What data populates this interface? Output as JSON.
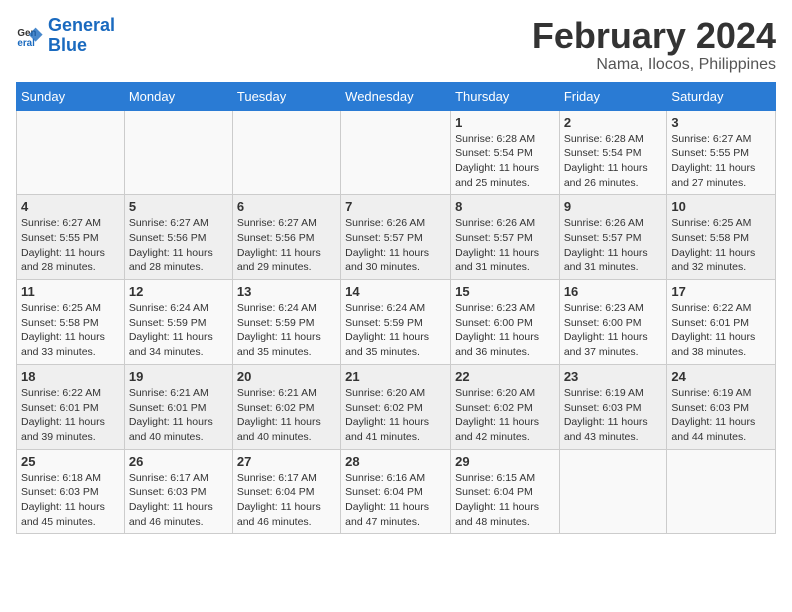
{
  "logo": {
    "line1": "General",
    "line2": "Blue"
  },
  "title": "February 2024",
  "location": "Nama, Ilocos, Philippines",
  "days_header": [
    "Sunday",
    "Monday",
    "Tuesday",
    "Wednesday",
    "Thursday",
    "Friday",
    "Saturday"
  ],
  "weeks": [
    [
      {
        "num": "",
        "info": ""
      },
      {
        "num": "",
        "info": ""
      },
      {
        "num": "",
        "info": ""
      },
      {
        "num": "",
        "info": ""
      },
      {
        "num": "1",
        "info": "Sunrise: 6:28 AM\nSunset: 5:54 PM\nDaylight: 11 hours and 25 minutes."
      },
      {
        "num": "2",
        "info": "Sunrise: 6:28 AM\nSunset: 5:54 PM\nDaylight: 11 hours and 26 minutes."
      },
      {
        "num": "3",
        "info": "Sunrise: 6:27 AM\nSunset: 5:55 PM\nDaylight: 11 hours and 27 minutes."
      }
    ],
    [
      {
        "num": "4",
        "info": "Sunrise: 6:27 AM\nSunset: 5:55 PM\nDaylight: 11 hours and 28 minutes."
      },
      {
        "num": "5",
        "info": "Sunrise: 6:27 AM\nSunset: 5:56 PM\nDaylight: 11 hours and 28 minutes."
      },
      {
        "num": "6",
        "info": "Sunrise: 6:27 AM\nSunset: 5:56 PM\nDaylight: 11 hours and 29 minutes."
      },
      {
        "num": "7",
        "info": "Sunrise: 6:26 AM\nSunset: 5:57 PM\nDaylight: 11 hours and 30 minutes."
      },
      {
        "num": "8",
        "info": "Sunrise: 6:26 AM\nSunset: 5:57 PM\nDaylight: 11 hours and 31 minutes."
      },
      {
        "num": "9",
        "info": "Sunrise: 6:26 AM\nSunset: 5:57 PM\nDaylight: 11 hours and 31 minutes."
      },
      {
        "num": "10",
        "info": "Sunrise: 6:25 AM\nSunset: 5:58 PM\nDaylight: 11 hours and 32 minutes."
      }
    ],
    [
      {
        "num": "11",
        "info": "Sunrise: 6:25 AM\nSunset: 5:58 PM\nDaylight: 11 hours and 33 minutes."
      },
      {
        "num": "12",
        "info": "Sunrise: 6:24 AM\nSunset: 5:59 PM\nDaylight: 11 hours and 34 minutes."
      },
      {
        "num": "13",
        "info": "Sunrise: 6:24 AM\nSunset: 5:59 PM\nDaylight: 11 hours and 35 minutes."
      },
      {
        "num": "14",
        "info": "Sunrise: 6:24 AM\nSunset: 5:59 PM\nDaylight: 11 hours and 35 minutes."
      },
      {
        "num": "15",
        "info": "Sunrise: 6:23 AM\nSunset: 6:00 PM\nDaylight: 11 hours and 36 minutes."
      },
      {
        "num": "16",
        "info": "Sunrise: 6:23 AM\nSunset: 6:00 PM\nDaylight: 11 hours and 37 minutes."
      },
      {
        "num": "17",
        "info": "Sunrise: 6:22 AM\nSunset: 6:01 PM\nDaylight: 11 hours and 38 minutes."
      }
    ],
    [
      {
        "num": "18",
        "info": "Sunrise: 6:22 AM\nSunset: 6:01 PM\nDaylight: 11 hours and 39 minutes."
      },
      {
        "num": "19",
        "info": "Sunrise: 6:21 AM\nSunset: 6:01 PM\nDaylight: 11 hours and 40 minutes."
      },
      {
        "num": "20",
        "info": "Sunrise: 6:21 AM\nSunset: 6:02 PM\nDaylight: 11 hours and 40 minutes."
      },
      {
        "num": "21",
        "info": "Sunrise: 6:20 AM\nSunset: 6:02 PM\nDaylight: 11 hours and 41 minutes."
      },
      {
        "num": "22",
        "info": "Sunrise: 6:20 AM\nSunset: 6:02 PM\nDaylight: 11 hours and 42 minutes."
      },
      {
        "num": "23",
        "info": "Sunrise: 6:19 AM\nSunset: 6:03 PM\nDaylight: 11 hours and 43 minutes."
      },
      {
        "num": "24",
        "info": "Sunrise: 6:19 AM\nSunset: 6:03 PM\nDaylight: 11 hours and 44 minutes."
      }
    ],
    [
      {
        "num": "25",
        "info": "Sunrise: 6:18 AM\nSunset: 6:03 PM\nDaylight: 11 hours and 45 minutes."
      },
      {
        "num": "26",
        "info": "Sunrise: 6:17 AM\nSunset: 6:03 PM\nDaylight: 11 hours and 46 minutes."
      },
      {
        "num": "27",
        "info": "Sunrise: 6:17 AM\nSunset: 6:04 PM\nDaylight: 11 hours and 46 minutes."
      },
      {
        "num": "28",
        "info": "Sunrise: 6:16 AM\nSunset: 6:04 PM\nDaylight: 11 hours and 47 minutes."
      },
      {
        "num": "29",
        "info": "Sunrise: 6:15 AM\nSunset: 6:04 PM\nDaylight: 11 hours and 48 minutes."
      },
      {
        "num": "",
        "info": ""
      },
      {
        "num": "",
        "info": ""
      }
    ]
  ]
}
